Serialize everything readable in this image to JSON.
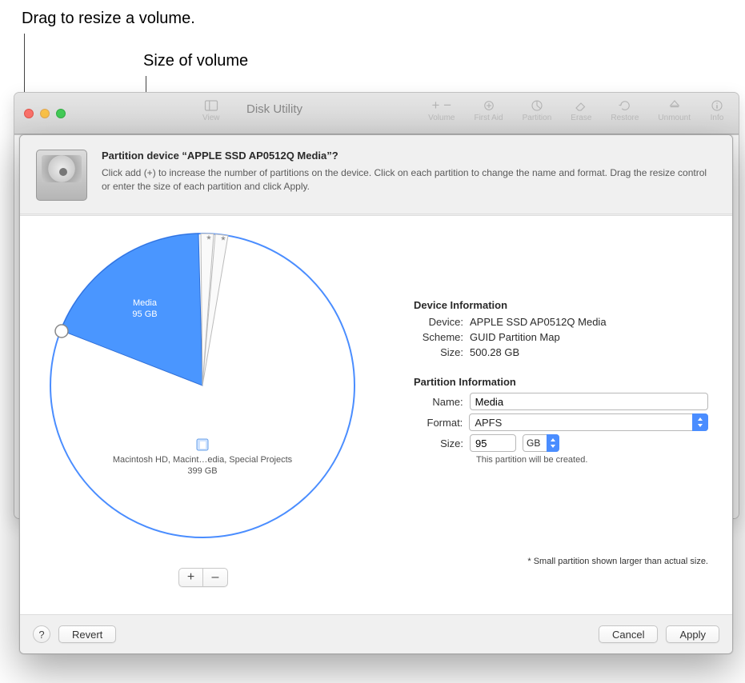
{
  "annotations": {
    "resize": "Drag to resize a volume.",
    "size": "Size of volume"
  },
  "window": {
    "title": "Disk Utility",
    "toolbar": {
      "view": "View",
      "volume": "Volume",
      "firstaid": "First Aid",
      "partition": "Partition",
      "erase": "Erase",
      "restore": "Restore",
      "unmount": "Unmount",
      "info": "Info"
    }
  },
  "sheet": {
    "title": "Partition device “APPLE SSD AP0512Q Media”?",
    "description": "Click add (+) to increase the number of partitions on the device. Click on each partition to change the name and format. Drag the resize control or enter the size of each partition and click Apply.",
    "add_label": "+",
    "remove_label": "–",
    "footnote": "* Small partition shown larger than actual size."
  },
  "pie": {
    "selected": {
      "name": "Media",
      "size_label": "95 GB"
    },
    "main": {
      "name": "Macintosh HD, Macint…edia, Special Projects",
      "size_label": "399 GB"
    },
    "asterisk": "*"
  },
  "device_info": {
    "header": "Device Information",
    "device_lbl": "Device:",
    "device_val": "APPLE SSD AP0512Q Media",
    "scheme_lbl": "Scheme:",
    "scheme_val": "GUID Partition Map",
    "size_lbl": "Size:",
    "size_val": "500.28 GB"
  },
  "partition_info": {
    "header": "Partition Information",
    "name_lbl": "Name:",
    "name_val": "Media",
    "format_lbl": "Format:",
    "format_val": "APFS",
    "size_lbl": "Size:",
    "size_val": "95",
    "unit_val": "GB",
    "status": "This partition will be created."
  },
  "buttons": {
    "help": "?",
    "revert": "Revert",
    "cancel": "Cancel",
    "apply": "Apply"
  },
  "chart_data": {
    "type": "pie",
    "title": "Partition layout of APPLE SSD AP0512Q Media (500.28 GB)",
    "series": [
      {
        "name": "Media",
        "value_gb": 95,
        "note": "selected, will be created"
      },
      {
        "name": "small partition *",
        "value_gb": 3,
        "note": "shown larger than actual size"
      },
      {
        "name": "small partition *",
        "value_gb": 3,
        "note": "shown larger than actual size"
      },
      {
        "name": "Macintosh HD, Macint…edia, Special Projects",
        "value_gb": 399
      }
    ],
    "total_gb": 500.28
  }
}
